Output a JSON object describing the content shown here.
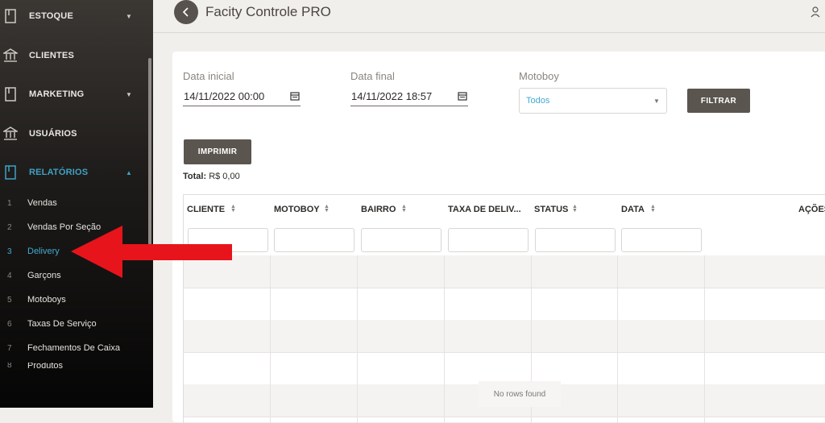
{
  "sidebar": {
    "items": [
      {
        "label": "ESTOQUE",
        "icon": "book-icon",
        "caret": "▼"
      },
      {
        "label": "CLIENTES",
        "icon": "bank-icon"
      },
      {
        "label": "MARKETING",
        "icon": "book-icon",
        "caret": "▼"
      },
      {
        "label": "USUÁRIOS",
        "icon": "bank-icon"
      },
      {
        "label": "RELATÓRIOS",
        "icon": "book-icon",
        "caret": "▲",
        "active": true
      }
    ],
    "subitems": [
      {
        "num": "1",
        "label": "Vendas"
      },
      {
        "num": "2",
        "label": "Vendas Por Seção"
      },
      {
        "num": "3",
        "label": "Delivery",
        "active": true
      },
      {
        "num": "4",
        "label": "Garçons"
      },
      {
        "num": "5",
        "label": "Motoboys"
      },
      {
        "num": "6",
        "label": "Taxas De Serviço"
      },
      {
        "num": "7",
        "label": "Fechamentos De Caixa"
      },
      {
        "num": "8",
        "label": "Produtos"
      }
    ]
  },
  "header": {
    "title": "Facity Controle PRO",
    "back_icon": "chevron-left-icon",
    "user_icon": "user-icon"
  },
  "filters": {
    "start_label": "Data inicial",
    "start_value": "14/11/2022 00:00",
    "end_label": "Data final",
    "end_value": "14/11/2022 18:57",
    "motoboy_label": "Motoboy",
    "motoboy_value": "Todos",
    "filter_button": "FILTRAR"
  },
  "print_button": "IMPRIMIR",
  "total": {
    "label": "Total:",
    "value": "R$ 0,00"
  },
  "table": {
    "columns": [
      "CLIENTE",
      "MOTOBOY",
      "BAIRRO",
      "TAXA DE DELIV...",
      "STATUS",
      "DATA",
      "AÇÕES"
    ],
    "empty_text": "No rows found"
  },
  "colors": {
    "accent": "#43a9d0",
    "arrow": "#e8141b",
    "button": "#5b554f"
  }
}
